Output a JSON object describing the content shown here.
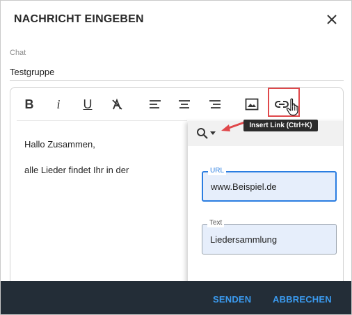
{
  "dialog": {
    "title": "NACHRICHT EINGEBEN",
    "close_icon": "close-icon"
  },
  "chat": {
    "label": "Chat",
    "value": "Testgruppe"
  },
  "toolbar": {
    "buttons": [
      {
        "id": "bold",
        "label": "B"
      },
      {
        "id": "italic",
        "label": "i"
      },
      {
        "id": "underline",
        "label": "U"
      },
      {
        "id": "clear-format",
        "icon": "clear-format-icon"
      },
      {
        "id": "align-left",
        "icon": "align-left-icon"
      },
      {
        "id": "align-center",
        "icon": "align-center-icon"
      },
      {
        "id": "align-right",
        "icon": "align-right-icon"
      },
      {
        "id": "insert-image",
        "icon": "image-icon"
      },
      {
        "id": "insert-link",
        "icon": "link-icon"
      }
    ],
    "tooltip": "Insert Link (Ctrl+K)"
  },
  "editor": {
    "line1": "Hallo Zusammen,",
    "line2": "alle Lieder findet Ihr in der"
  },
  "link_panel": {
    "search_icon": "search-icon",
    "url_label": "URL",
    "url_value": "www.Beispiel.de",
    "text_label": "Text",
    "text_value": "Liedersammlung"
  },
  "footer": {
    "send_label": "SENDEN",
    "cancel_label": "ABBRECHEN"
  },
  "colors": {
    "accent": "#2a7de1",
    "footer_bg": "#232d37",
    "footer_button": "#3b9bf0",
    "highlight": "#e0484b"
  }
}
